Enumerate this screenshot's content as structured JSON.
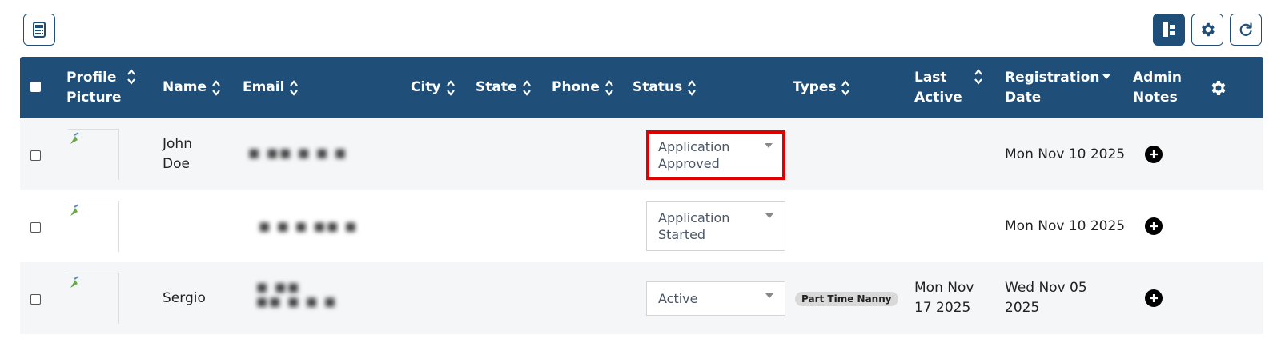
{
  "toolbar": {
    "left_icon": "calculator-icon",
    "right_icons": [
      "tree-view-icon",
      "gear-icon",
      "refresh-icon"
    ]
  },
  "columns": [
    {
      "label": "Profile Picture",
      "sort": "both"
    },
    {
      "label": "Name",
      "sort": "both"
    },
    {
      "label": "Email",
      "sort": "both"
    },
    {
      "label": "City",
      "sort": "both"
    },
    {
      "label": "State",
      "sort": "both"
    },
    {
      "label": "Phone",
      "sort": "both"
    },
    {
      "label": "Status",
      "sort": "both"
    },
    {
      "label": "Types",
      "sort": "both"
    },
    {
      "label": "Last Active",
      "sort": "both"
    },
    {
      "label": "Registration Date",
      "sort": "desc"
    },
    {
      "label": "Admin Notes",
      "sort": "none"
    }
  ],
  "header_gear_icon": "gear-icon",
  "rows": [
    {
      "name": "John Doe",
      "status": "Application Approved",
      "types": "",
      "last_active": "",
      "registration_date": "Mon Nov 10 2025"
    },
    {
      "name": "",
      "status": "Application Started",
      "types": "",
      "last_active": "",
      "registration_date": "Mon Nov 10 2025"
    },
    {
      "name": "Sergio",
      "status": "Active",
      "types": "Part Time Nanny",
      "last_active": "Mon Nov 17 2025",
      "registration_date": "Wed Nov 05 2025"
    }
  ],
  "colors": {
    "header_bg": "#1f4e79",
    "highlight": "#e00000"
  }
}
